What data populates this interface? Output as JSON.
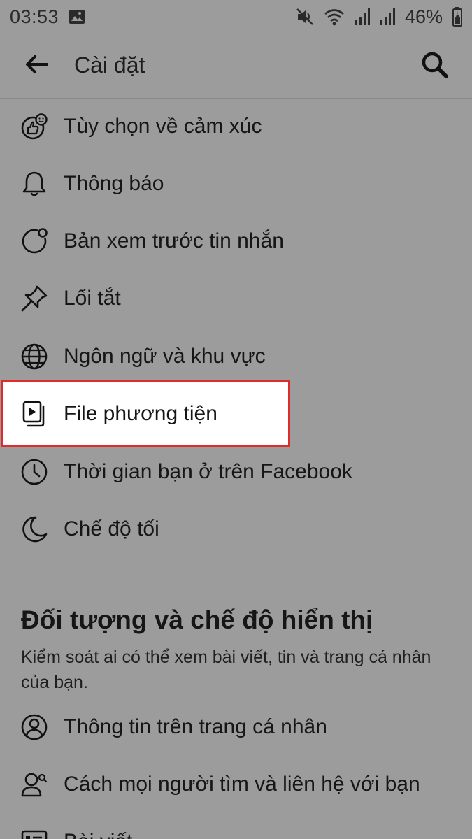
{
  "status_bar": {
    "time": "03:53",
    "battery": "46%",
    "icons": [
      "image-icon",
      "mute-icon",
      "wifi-icon",
      "signal-icon",
      "signal-icon",
      "battery-icon"
    ]
  },
  "header": {
    "title": "Cài đặt",
    "back_icon": "arrow-left-icon",
    "search_icon": "search-icon"
  },
  "menu": {
    "items": [
      {
        "label": "Tùy chọn về cảm xúc",
        "icon": "reaction-icon"
      },
      {
        "label": "Thông báo",
        "icon": "bell-icon"
      },
      {
        "label": "Bản xem trước tin nhắn",
        "icon": "message-preview-icon"
      },
      {
        "label": "Lối tắt",
        "icon": "pin-icon"
      },
      {
        "label": "Ngôn ngữ và khu vực",
        "icon": "globe-icon"
      },
      {
        "label": "File phương tiện",
        "icon": "media-icon",
        "highlighted": true
      },
      {
        "label": "Thời gian bạn ở trên Facebook",
        "icon": "clock-icon"
      },
      {
        "label": "Chế độ tối",
        "icon": "moon-icon"
      }
    ]
  },
  "audience_section": {
    "title": "Đối tượng và chế độ hiển thị",
    "description": "Kiểm soát ai có thể xem bài viết, tin và trang cá nhân của bạn.",
    "items": [
      {
        "label": "Thông tin trên trang cá nhân",
        "icon": "profile-icon"
      },
      {
        "label": "Cách mọi người tìm và liên hệ với bạn",
        "icon": "find-people-icon"
      },
      {
        "label": "Bài viết",
        "icon": "posts-icon"
      }
    ]
  },
  "colors": {
    "background": "#9c9c9c",
    "highlight_border": "#e12b2b",
    "highlight_fill": "#ffffff"
  }
}
